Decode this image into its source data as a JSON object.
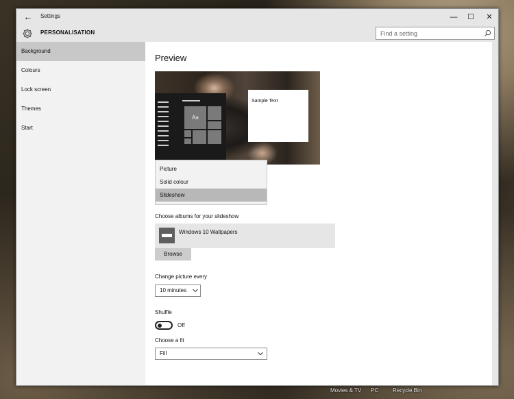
{
  "window": {
    "title": "Settings",
    "section": "PERSONALISATION",
    "controls": {
      "minimize": "—",
      "maximize": "☐",
      "close": "✕"
    },
    "back_glyph": "←"
  },
  "search": {
    "placeholder": "Find a setting",
    "value": ""
  },
  "sidebar": {
    "items": [
      {
        "label": "Background",
        "active": true
      },
      {
        "label": "Colours",
        "active": false
      },
      {
        "label": "Lock screen",
        "active": false
      },
      {
        "label": "Themes",
        "active": false
      },
      {
        "label": "Start",
        "active": false
      }
    ]
  },
  "main": {
    "preview_heading": "Preview",
    "preview": {
      "tile_text": "Aa",
      "sample_text": "Sample Text"
    },
    "background_dropdown": {
      "options": [
        "Picture",
        "Solid colour",
        "Slideshow"
      ],
      "selected": "Slideshow"
    },
    "albums": {
      "label": "Choose albums for your slideshow",
      "album_name": "Windows 10 Wallpapers",
      "browse_label": "Browse"
    },
    "change_picture": {
      "label": "Change picture every",
      "value": "10 minutes"
    },
    "shuffle": {
      "label": "Shuffle",
      "state_label": "Off",
      "on": false
    },
    "fit": {
      "label": "Choose a fit",
      "value": "Fill"
    }
  },
  "desktop": {
    "icon_labels": [
      "Movies & TV",
      "PC",
      "Recycle Bin"
    ]
  },
  "colors": {
    "chrome": "#e6e6e6",
    "sidebar": "#f2f2f2",
    "sidebar_active": "#c8c8c8",
    "dropdown_selected": "#b8b8b8"
  }
}
